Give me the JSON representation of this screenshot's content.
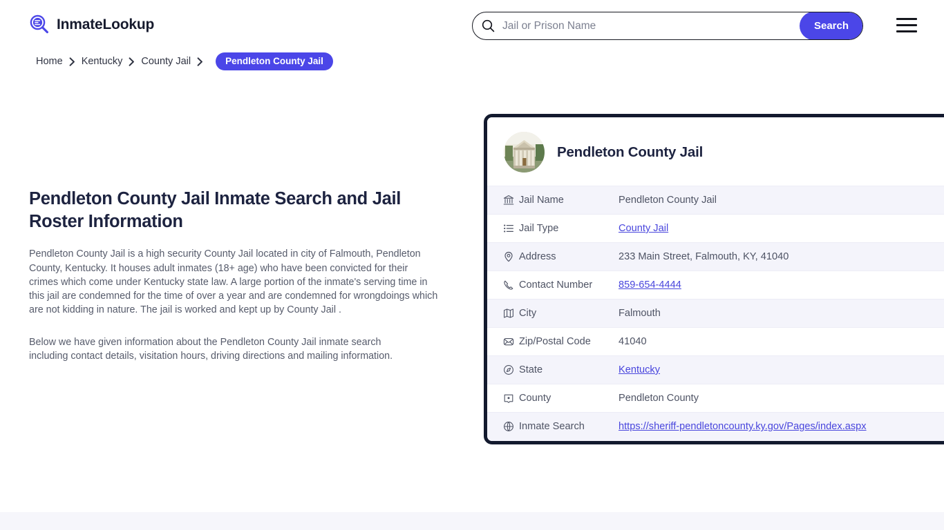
{
  "header": {
    "brand_name": "InmateLookup",
    "brand_logo_icon": "magnifier-list-icon",
    "menu_icon": "hamburger-menu-icon",
    "accent_color": "#4b46e8",
    "dark_color": "#131a2e"
  },
  "search": {
    "icon": "search-icon",
    "value": "",
    "placeholder": "Jail or Prison Name",
    "button_label": "Search"
  },
  "breadcrumb": {
    "items": [
      {
        "label": "Home",
        "current": false
      },
      {
        "label": "Kentucky",
        "current": false
      },
      {
        "label": "County Jail",
        "current": false
      },
      {
        "label": "Pendleton County Jail",
        "current": true
      }
    ],
    "separator_icon": "chevron-right-icon"
  },
  "main": {
    "page_title": "Pendleton County Jail Inmate Search and Jail Roster Information",
    "paragraph_1": "Pendleton County Jail is a high security County Jail located in city of Falmouth, Pendleton County, Kentucky. It houses adult inmates (18+ age) who have been convicted for their crimes which come under Kentucky state law. A large portion of the inmate's serving time in this jail are condemned for the time of over a year and are condemned for wrongdoings which are not kidding in nature. The jail is worked and kept up by County Jail .",
    "paragraph_2": "Below we have given information about the Pendleton County Jail inmate search including contact details, visitation hours, driving directions and mailing information."
  },
  "info_card": {
    "avatar_icon": "courthouse-building-photo",
    "title": "Pendleton County Jail",
    "rows": [
      {
        "icon": "bank-building-icon",
        "label": "Jail Name",
        "value": "Pendleton County Jail",
        "link": false
      },
      {
        "icon": "list-icon",
        "label": "Jail Type",
        "value": "County Jail",
        "link": true
      },
      {
        "icon": "map-pin-icon",
        "label": "Address",
        "value": "233 Main Street, Falmouth, KY, 41040",
        "link": false
      },
      {
        "icon": "phone-icon",
        "label": "Contact Number",
        "value": "859-654-4444",
        "link": true
      },
      {
        "icon": "map-icon",
        "label": "City",
        "value": "Falmouth",
        "link": false
      },
      {
        "icon": "envelope-icon",
        "label": "Zip/Postal Code",
        "value": "41040",
        "link": false
      },
      {
        "icon": "compass-icon",
        "label": "State",
        "value": "Kentucky",
        "link": true
      },
      {
        "icon": "county-marker-icon",
        "label": "County",
        "value": "Pendleton County",
        "link": false
      },
      {
        "icon": "globe-icon",
        "label": "Inmate Search",
        "value": "https://sheriff-pendletoncounty.ky.gov/Pages/index.aspx",
        "link": true
      }
    ]
  }
}
